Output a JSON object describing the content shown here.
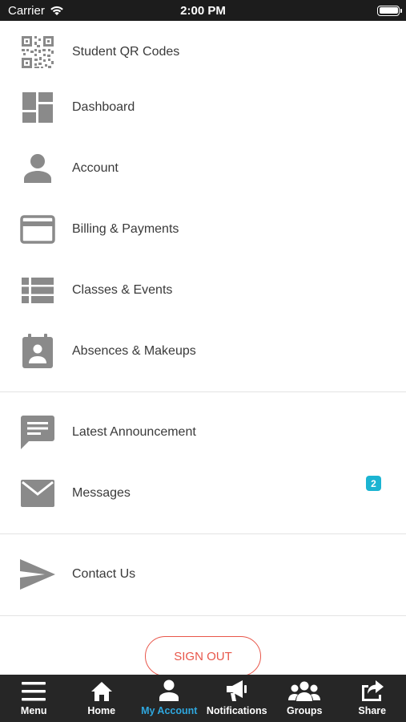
{
  "status_bar": {
    "carrier": "Carrier",
    "time": "2:00 PM"
  },
  "menu": {
    "items": [
      {
        "label": "Student QR Codes",
        "icon": "qr-code-icon"
      },
      {
        "label": "Dashboard",
        "icon": "dashboard-icon"
      },
      {
        "label": "Account",
        "icon": "person-icon"
      },
      {
        "label": "Billing & Payments",
        "icon": "credit-card-icon"
      },
      {
        "label": "Classes & Events",
        "icon": "list-icon"
      },
      {
        "label": "Absences & Makeups",
        "icon": "calendar-person-icon"
      },
      {
        "label": "Latest Announcement",
        "icon": "chat-bubble-icon"
      },
      {
        "label": "Messages",
        "icon": "envelope-icon",
        "badge": "2"
      },
      {
        "label": "Contact Us",
        "icon": "paper-plane-icon"
      }
    ]
  },
  "sign_out_label": "SIGN OUT",
  "tabs": [
    {
      "label": "Menu",
      "icon": "hamburger-icon",
      "active": false
    },
    {
      "label": "Home",
      "icon": "home-icon",
      "active": false
    },
    {
      "label": "My Account",
      "icon": "person-icon",
      "active": true
    },
    {
      "label": "Notifications",
      "icon": "megaphone-icon",
      "active": false
    },
    {
      "label": "Groups",
      "icon": "group-icon",
      "active": false
    },
    {
      "label": "Share",
      "icon": "share-icon",
      "active": false
    }
  ],
  "colors": {
    "icon_gray": "#8a8a8a",
    "badge": "#1bb4d2",
    "sign_out": "#e8564a",
    "tab_active": "#2fa7de",
    "tab_bar": "#262626"
  }
}
